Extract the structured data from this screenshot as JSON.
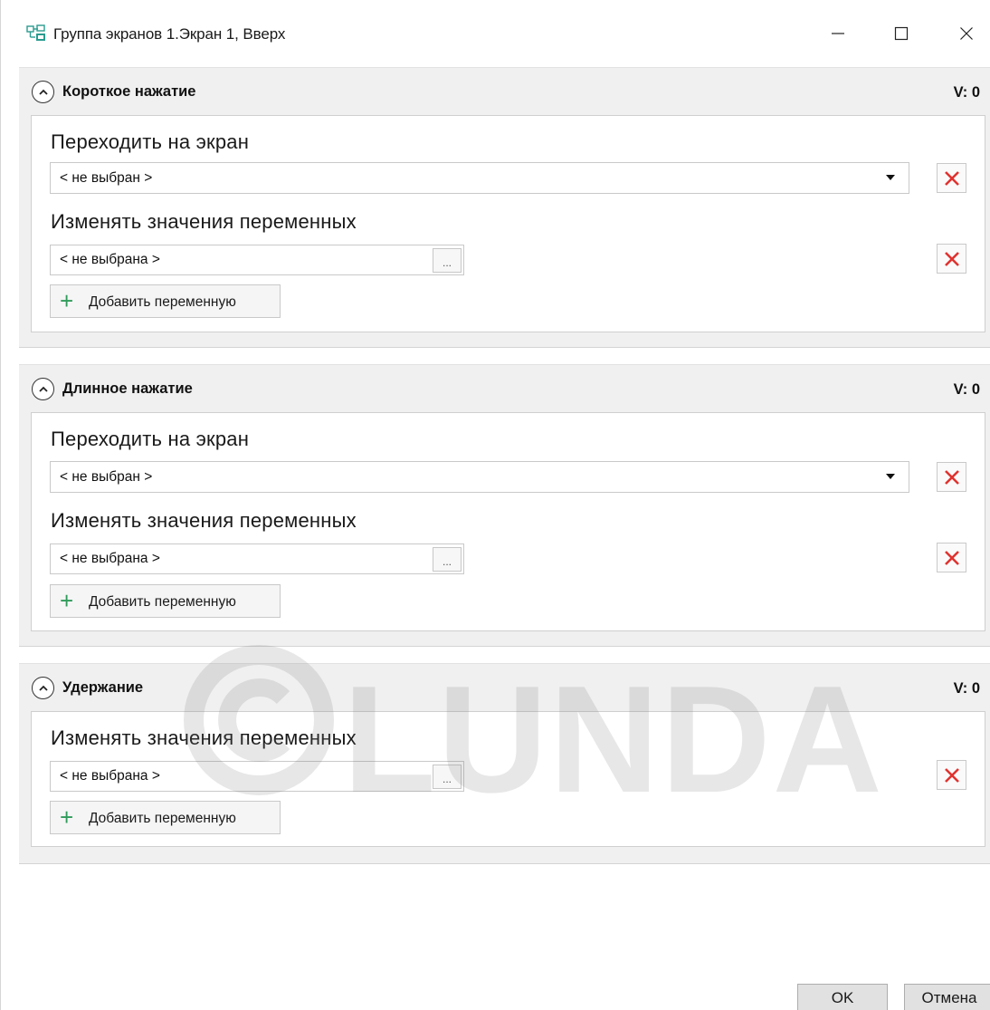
{
  "window": {
    "title": "Группа экранов 1.Экран 1, Вверх",
    "icon": "screen-group-icon",
    "controls": [
      "minimize-icon",
      "maximize-icon",
      "close-icon"
    ]
  },
  "groups": [
    {
      "title": "Короткое нажатие",
      "v_label": "V: 0",
      "screen_label": "Переходить на экран",
      "screen_value": "< не выбран >",
      "vars_label": "Изменять значения переменных",
      "var_value": "< не выбрана >",
      "var_browse": "...",
      "add_label": "Добавить переменную"
    },
    {
      "title": "Длинное нажатие",
      "v_label": "V: 0",
      "screen_label": "Переходить на экран",
      "screen_value": "< не выбран >",
      "vars_label": "Изменять значения переменных",
      "var_value": "< не выбрана >",
      "var_browse": "...",
      "add_label": "Добавить переменную"
    },
    {
      "title": "Удержание",
      "v_label": "V: 0",
      "vars_label": "Изменять значения переменных",
      "var_value": "< не выбрана >",
      "var_browse": "...",
      "add_label": "Добавить переменную"
    }
  ],
  "watermark": {
    "text": "LUNDA",
    "symbol": "©"
  },
  "footer": {
    "ok_label": "OK",
    "cancel_label": "Отмена"
  },
  "colors": {
    "delete_red": "#e0322f",
    "plus_green": "#2f9b5a",
    "group_bg": "#f0f0f0"
  }
}
